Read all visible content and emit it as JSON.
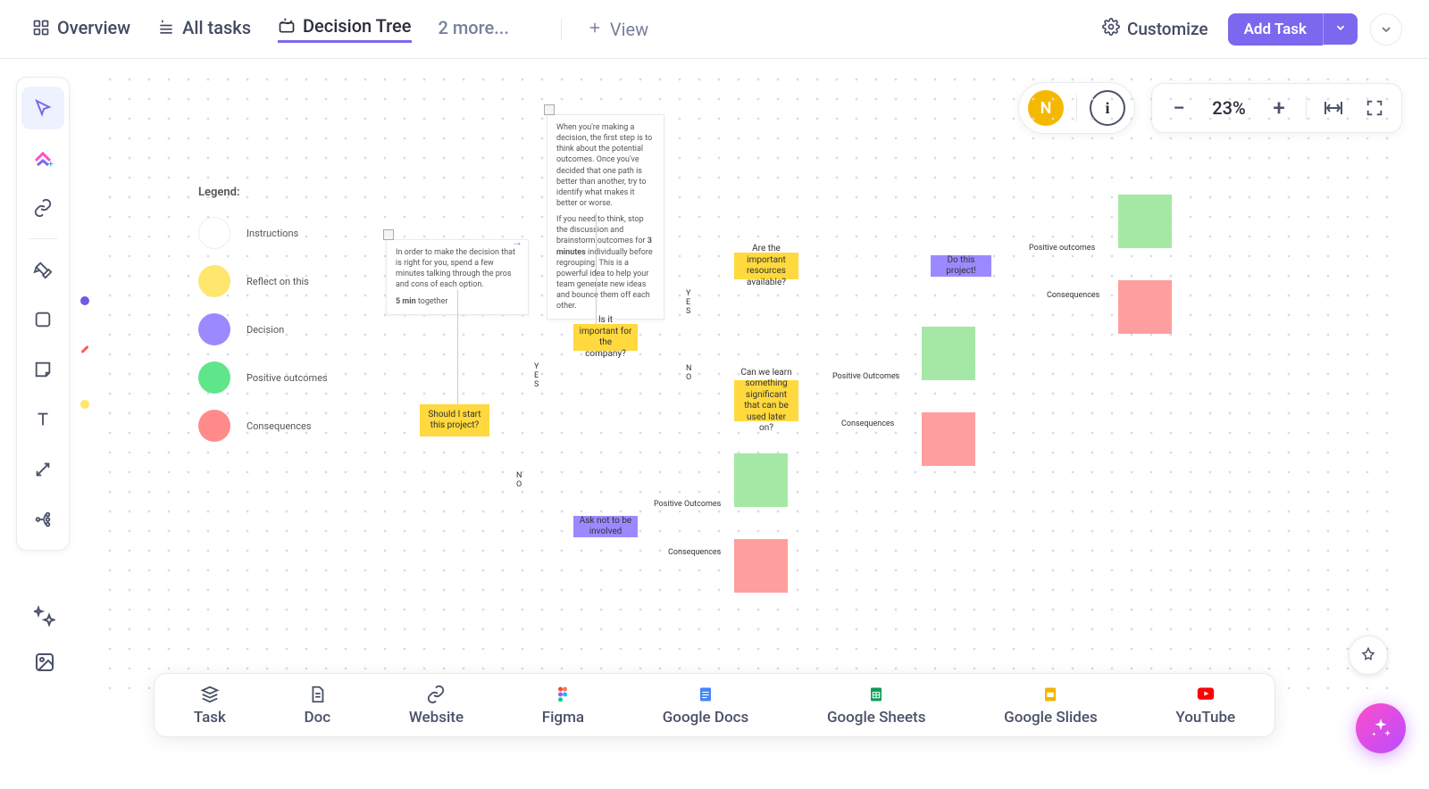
{
  "tabs": {
    "overview": "Overview",
    "alltasks": "All tasks",
    "decisiontree": "Decision Tree",
    "more": "2 more...",
    "view": "View"
  },
  "header": {
    "customize": "Customize",
    "addtask": "Add Task"
  },
  "avatar": {
    "initial": "N"
  },
  "zoom": {
    "level": "23%"
  },
  "legend": {
    "title": "Legend:",
    "items": [
      {
        "color": "#FFFFFF",
        "label": "Instructions"
      },
      {
        "color": "#FFE66D",
        "label": "Reflect on this"
      },
      {
        "color": "#9B8AFF",
        "label": "Decision"
      },
      {
        "color": "#5FE68A",
        "label": "Positive outcomes"
      },
      {
        "color": "#FF8B8B",
        "label": "Consequences"
      }
    ]
  },
  "notes": {
    "big": {
      "p1": "When you're making a decision, the first step is to think about the potential outcomes. Once you've decided that one path is better than another, try to identify what makes it better or worse.",
      "p2a": "If you need to think, stop the discussion and brainstorm outcomes for ",
      "p2b": "3 minutes",
      "p2c": " individually before regrouping. This is a powerful idea to help your team generate new ideas and bounce them off each other."
    },
    "small": {
      "p1": "In order to make the decision that is right for you, spend a few minutes talking through the pros and cons of each option.",
      "time": "5 min",
      "time2": " together"
    }
  },
  "nodes": {
    "start": "Should I start this project?",
    "important": "Is it important for the company?",
    "askNot": "Ask not to be involved",
    "resources": "Are the important resources available?",
    "learn": "Can we learn something significant that can be used later on?",
    "doProject": "Do this project!"
  },
  "edges": {
    "yes": "YES",
    "no": "NO",
    "positive": "Positive Outcomes",
    "positive2": "Positive outcomes",
    "consequences": "Consequences"
  },
  "cards": {
    "task": "Task",
    "doc": "Doc",
    "website": "Website",
    "figma": "Figma",
    "gdocs": "Google Docs",
    "gsheets": "Google Sheets",
    "gslides": "Google Slides",
    "youtube": "YouTube"
  }
}
